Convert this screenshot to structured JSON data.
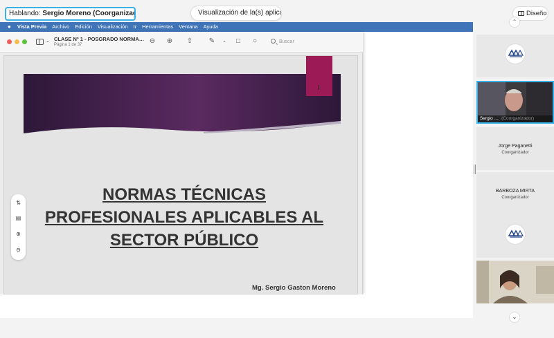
{
  "header": {
    "speaking_label": "Hablando:",
    "speaking_name": "Sergio Moreno (Coorganizador)",
    "share_label": "Visualización de la(s) aplica…",
    "layout_label": "Diseño"
  },
  "macmenu": {
    "app_name": "Vista Previa",
    "items": [
      "Archivo",
      "Edición",
      "Visualización",
      "Ir",
      "Herramientas",
      "Ventana",
      "Ayuda"
    ]
  },
  "preview": {
    "doc_title": "CLASE Nº 1 - POSGRADO NORMA…",
    "page_info": "Página 1 de 37",
    "search_placeholder": "Buscar"
  },
  "slide": {
    "title_lines": [
      "NORMAS TÉCNICAS",
      "PROFESIONALES APLICABLES AL",
      "SECTOR PÚBLICO"
    ],
    "author": "Mg. Sergio Gaston Moreno",
    "colors": {
      "banner": "#4a2a52",
      "bookmark": "#9c1a55"
    }
  },
  "participants": [
    {
      "type": "logo"
    },
    {
      "type": "video",
      "name": "Sergio …",
      "role": "(Coorganizador)",
      "active": true
    },
    {
      "type": "name",
      "name": "Jorge Paganetti",
      "role": "Coorganizador"
    },
    {
      "type": "name",
      "name": "BARBOZA MIRTA",
      "role": "Coorganizador"
    },
    {
      "type": "logo"
    },
    {
      "type": "video"
    }
  ]
}
